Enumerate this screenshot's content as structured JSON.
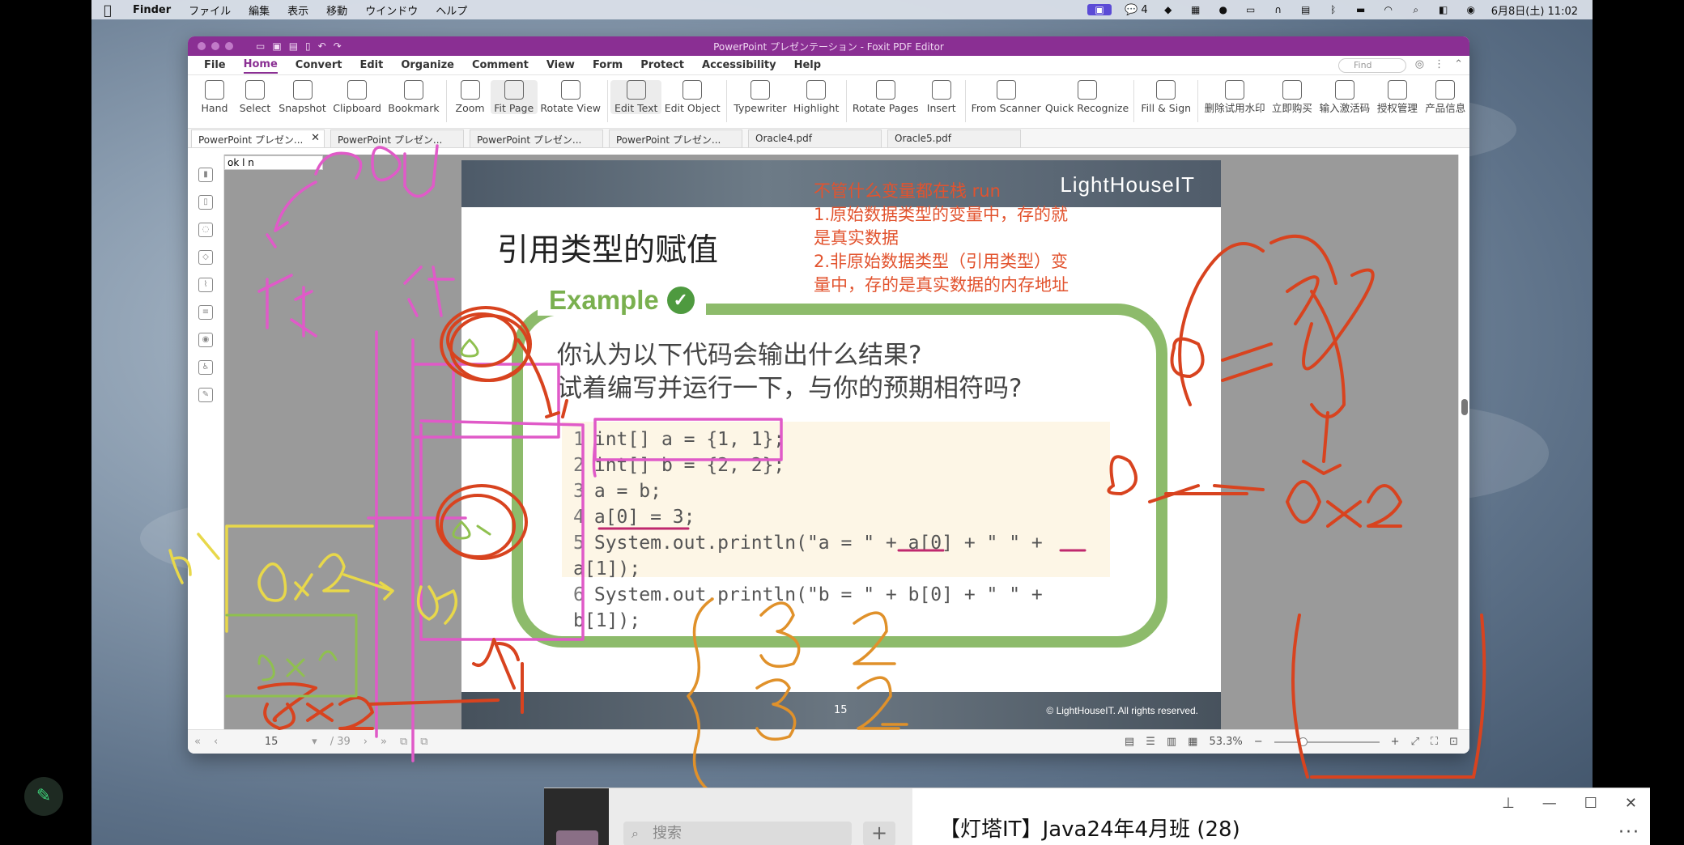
{
  "menubar": {
    "apple": "",
    "items": [
      "Finder",
      "ファイル",
      "編集",
      "表示",
      "移動",
      "ウインドウ",
      "ヘルプ"
    ],
    "wechat_count": "4",
    "clock": "6月8日(土) 11:02"
  },
  "window": {
    "title": "PowerPoint プレゼンテーション - Foxit PDF Editor",
    "menus": [
      "File",
      "Home",
      "Convert",
      "Edit",
      "Organize",
      "Comment",
      "View",
      "Form",
      "Protect",
      "Accessibility",
      "Help"
    ],
    "active_menu": "Home",
    "find_placeholder": "Find",
    "ribbon": [
      {
        "label": "Hand",
        "icon": "hand-icon"
      },
      {
        "label": "Select",
        "icon": "select-icon"
      },
      {
        "label": "Snapshot",
        "icon": "snapshot-icon"
      },
      {
        "label": "Clipboard",
        "icon": "clipboard-icon"
      },
      {
        "label": "Bookmark",
        "icon": "bookmark-icon"
      },
      {
        "label": "Zoom",
        "icon": "zoom-icon"
      },
      {
        "label": "Fit Page",
        "icon": "fit-page-icon"
      },
      {
        "label": "Rotate View",
        "icon": "rotate-view-icon"
      },
      {
        "label": "Edit Text",
        "icon": "edit-text-icon"
      },
      {
        "label": "Edit Object",
        "icon": "edit-object-icon"
      },
      {
        "label": "Typewriter",
        "icon": "typewriter-icon"
      },
      {
        "label": "Highlight",
        "icon": "highlight-icon"
      },
      {
        "label": "Rotate Pages",
        "icon": "rotate-pages-icon"
      },
      {
        "label": "Insert",
        "icon": "insert-icon"
      },
      {
        "label": "From Scanner",
        "icon": "scanner-icon"
      },
      {
        "label": "Quick Recognize",
        "icon": "ocr-icon"
      },
      {
        "label": "Fill & Sign",
        "icon": "fill-sign-icon"
      },
      {
        "label": "删除试用水印",
        "icon": "watermark-icon"
      },
      {
        "label": "立即购买",
        "icon": "cart-icon"
      },
      {
        "label": "输入激活码",
        "icon": "key-icon"
      },
      {
        "label": "授权管理",
        "icon": "license-icon"
      },
      {
        "label": "产品信息",
        "icon": "info-icon"
      }
    ],
    "tabs": [
      "PowerPoint プレゼン...",
      "PowerPoint プレゼン...",
      "PowerPoint プレゼン...",
      "PowerPoint プレゼン...",
      "Oracle4.pdf",
      "Oracle5.pdf"
    ],
    "note_text": "ok l n",
    "status": {
      "page": "15",
      "total": "/ 39",
      "zoom": "53.3%"
    }
  },
  "slide": {
    "brand": "LightHouseIT",
    "title": "引用类型的赋值",
    "example": "Example",
    "question1": "你认为以下代码会输出什么结果?",
    "question2": "试着编写并运行一下，与你的预期相符吗?",
    "code": [
      {
        "n": "1",
        "t": "int[] a = {1, 1};"
      },
      {
        "n": "2",
        "t": "int[] b = {2, 2};"
      },
      {
        "n": "3",
        "t": "a = b;"
      },
      {
        "n": "4",
        "t": "a[0] = 3;"
      },
      {
        "n": "5",
        "t": "System.out.println(\"a = \" + a[0] + \" \" + a[1]);"
      },
      {
        "n": "6",
        "t": "System.out.println(\"b = \" + b[0] + \" \" + b[1]);"
      }
    ],
    "page_number": "15",
    "copyright": "© LightHouseIT. All rights reserved.",
    "annotation_lines": [
      "不管什么变量都在栈 run",
      "1.原始数据类型的变量中，存的就",
      "是真实数据",
      "2.非原始数据类型（引用类型）变",
      "量中，存的是真实数据的内存地址"
    ]
  },
  "chat": {
    "search_placeholder": "搜索",
    "title": "【灯塔IT】Java24年4月班 (28)"
  },
  "colors": {
    "foxit_purple": "#8a2f93",
    "slide_green": "#8dbb6b",
    "ink_pink": "#e05ac8",
    "ink_red": "#d8431f",
    "ink_yellow": "#e8d84a",
    "ink_orange": "#e0912a",
    "ink_green": "#8fc04f"
  }
}
